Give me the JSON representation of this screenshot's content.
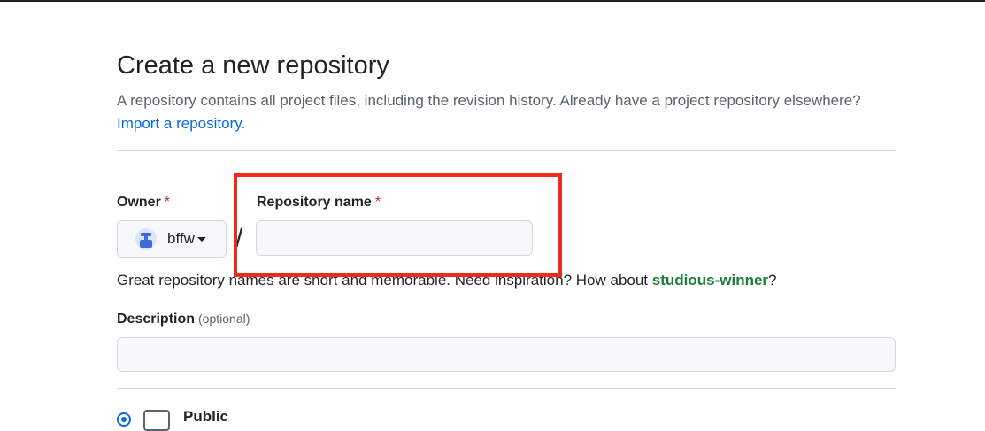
{
  "header": {
    "title": "Create a new repository",
    "subtitle": "A repository contains all project files, including the revision history. Already have a project repository elsewhere?",
    "import_link": "Import a repository."
  },
  "owner": {
    "label": "Owner",
    "required_mark": "*",
    "selected": "bffw",
    "avatar_icon": "identicon-avatar",
    "dropdown_icon": "caret-down-icon"
  },
  "separator": "/",
  "repo_name": {
    "label": "Repository name",
    "required_mark": "*",
    "value": "",
    "placeholder": ""
  },
  "name_hint": {
    "text": "Great repository names are short and memorable. Need inspiration? How about ",
    "suggestion": "studious-winner",
    "suffix": "?"
  },
  "description": {
    "label": "Description",
    "optional": "(optional)",
    "value": "",
    "placeholder": ""
  },
  "visibility": {
    "option_label": "Public",
    "selected": true,
    "icon": "repo-icon"
  },
  "colors": {
    "link": "#0969da",
    "suggestion": "#1a7f37",
    "required": "#d1242f",
    "highlight": "#ee2a1b"
  }
}
